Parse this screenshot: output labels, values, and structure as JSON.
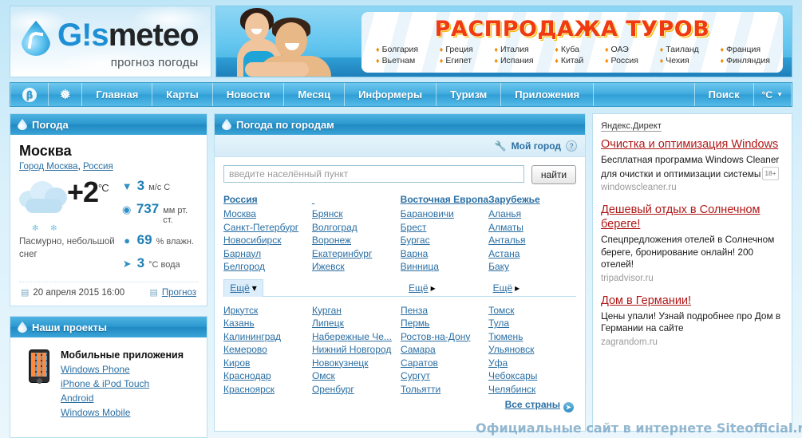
{
  "logo": {
    "name_part1": "G!s",
    "name_part2": "meteo",
    "tagline": "прогноз погоды",
    "drop_icon": "water-drop-icon"
  },
  "banner": {
    "title": "РАСПРОДАЖА ТУРОВ",
    "countries": [
      [
        "Болгария",
        "Вьетнам"
      ],
      [
        "Греция",
        "Египет"
      ],
      [
        "Италия",
        "Испания"
      ],
      [
        "Куба",
        "Китай"
      ],
      [
        "ОАЭ",
        "Россия"
      ],
      [
        "Таиланд",
        "Чехия"
      ],
      [
        "Франция",
        "Финляндия"
      ]
    ]
  },
  "nav": {
    "beta_icon": "β",
    "snow_icon": "❅",
    "items": [
      "Главная",
      "Карты",
      "Новости",
      "Месяц",
      "Информеры",
      "Туризм",
      "Приложения",
      "Поиск"
    ],
    "units": "°C",
    "units_caret": "▼"
  },
  "weather_panel": {
    "header": "Погода",
    "city": "Москва",
    "links": [
      {
        "label": "Город Москва"
      },
      {
        "label": "Россия"
      }
    ],
    "links_separator": ", ",
    "temperature": "+2",
    "temperature_unit": "°C",
    "description": "Пасмурно, небольшой снег",
    "metrics": [
      {
        "icon": "wind-arrow-icon",
        "glyph": "▼",
        "value": "3",
        "unit": "м/с  С"
      },
      {
        "icon": "pressure-gauge-icon",
        "glyph": "◉",
        "value": "737",
        "unit": "мм рт. ст."
      },
      {
        "icon": "humidity-drop-icon",
        "glyph": "💧",
        "value": "69",
        "unit": "% влажн."
      },
      {
        "icon": "water-fish-icon",
        "glyph": "➤",
        "value": "3",
        "unit": "°С вода"
      }
    ],
    "timestamp": "20 апреля 2015 16:00",
    "forecast_link": "Прогноз",
    "doc_icon": "document-icon"
  },
  "projects_panel": {
    "header": "Наши проекты",
    "title": "Мобильные приложения",
    "phone_icon": "smartphone-icon",
    "links": [
      "Windows Phone",
      "iPhone & iPod Touch",
      "Android",
      "Windows Mobile"
    ]
  },
  "cities_panel": {
    "header": "Погода по городам",
    "my_city": "Мой город",
    "wrench_icon": "wrench-icon",
    "help_icon": "question-mark-icon",
    "search": {
      "placeholder": "введите населённый пункт",
      "value": "",
      "button": "найти"
    },
    "columns_top": [
      {
        "header": "Россия",
        "cities": [
          "Москва",
          "Санкт-Петербург",
          "Новосибирск",
          "Барнаул",
          "Белгород"
        ]
      },
      {
        "header": "",
        "cities": [
          "Брянск",
          "Волгоград",
          "Воронеж",
          "Екатеринбург",
          "Ижевск"
        ]
      },
      {
        "header": "Восточная Европа",
        "cities": [
          "Барановичи",
          "Брест",
          "Бургас",
          "Варна",
          "Винница"
        ]
      },
      {
        "header": "Зарубежье",
        "cities": [
          "Аланья",
          "Алматы",
          "Анталья",
          "Астана",
          "Баку"
        ]
      }
    ],
    "more_tab": {
      "label": "Ещё",
      "caret": "▾"
    },
    "more_links": [
      {
        "label": "Ещё",
        "caret": "▸"
      },
      {
        "label": "Ещё",
        "caret": "▸"
      }
    ],
    "columns_bottom": [
      [
        "Иркутск",
        "Казань",
        "Калининград",
        "Кемерово",
        "Киров",
        "Краснодар",
        "Красноярск"
      ],
      [
        "Курган",
        "Липецк",
        "Набережные Че...",
        "Нижний Новгород",
        "Новокузнецк",
        "Омск",
        "Оренбург"
      ],
      [
        "Пенза",
        "Пермь",
        "Ростов-на-Дону",
        "Самара",
        "Саратов",
        "Сургут",
        "Тольятти"
      ],
      [
        "Томск",
        "Тула",
        "Тюмень",
        "Ульяновск",
        "Уфа",
        "Чебоксары",
        "Челябинск"
      ]
    ],
    "all_countries": "Все страны",
    "all_countries_icon": "circle-arrow-right-icon"
  },
  "ads": {
    "label": "Яндекс.Директ",
    "items": [
      {
        "title": "Очистка и оптимизация Windows",
        "text": "Бесплатная программа Windows Cleaner для очистки и оптимизации системы",
        "age": "18+",
        "url": "windowscleaner.ru"
      },
      {
        "title": "Дешевый отдых в Солнечном береге!",
        "text": "Спецпредложения отелей в Солнечном береге, бронирование онлайн! 200 отелей!",
        "age": "",
        "url": "tripadvisor.ru"
      },
      {
        "title": "Дом в Германии!",
        "text": "Цены упали! Узнай подробнее про Дом в Германии на сайте",
        "age": "",
        "url": "zagrandom.ru"
      }
    ]
  },
  "watermark": "Официальные сайт в интернете Siteofficial.ru",
  "colors": {
    "nav_blue": "#2f9ed5",
    "link_blue": "#2b6fa3",
    "ad_red": "#b01818",
    "banner_red": "#ef3a12",
    "panel_header": "#2089c2"
  }
}
